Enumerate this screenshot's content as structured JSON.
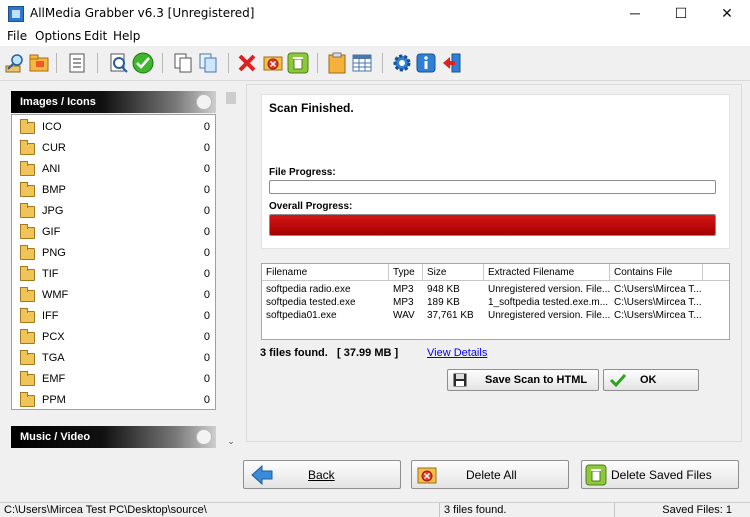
{
  "window": {
    "title": "AllMedia Grabber v6.3 [Unregistered]",
    "minimize": "─",
    "maximize": "☐",
    "close": "✕"
  },
  "menu": [
    "File",
    "Options",
    "Edit",
    "Help"
  ],
  "toolbar": {
    "icons": [
      "search-icon",
      "open-folder-icon",
      "list-icon",
      "scan-icon",
      "start-check-icon",
      "copy-icon",
      "duplicate-icon",
      "delete-x-icon",
      "delete-file-icon",
      "delete-saved-icon",
      "clipboard-icon",
      "table-icon",
      "settings-gear-icon",
      "info-icon",
      "exit-icon"
    ]
  },
  "categories": {
    "images": {
      "title": "Images / Icons",
      "items": [
        {
          "label": "ICO",
          "count": "0"
        },
        {
          "label": "CUR",
          "count": "0"
        },
        {
          "label": "ANI",
          "count": "0"
        },
        {
          "label": "BMP",
          "count": "0"
        },
        {
          "label": "JPG",
          "count": "0"
        },
        {
          "label": "GIF",
          "count": "0"
        },
        {
          "label": "PNG",
          "count": "0"
        },
        {
          "label": "TIF",
          "count": "0"
        },
        {
          "label": "WMF",
          "count": "0"
        },
        {
          "label": "IFF",
          "count": "0"
        },
        {
          "label": "PCX",
          "count": "0"
        },
        {
          "label": "TGA",
          "count": "0"
        },
        {
          "label": "EMF",
          "count": "0"
        },
        {
          "label": "PPM",
          "count": "0"
        }
      ]
    },
    "music": {
      "title": "Music / Video"
    }
  },
  "scan": {
    "status": "Scan Finished.",
    "file_progress_label": "File Progress:",
    "file_progress": 0,
    "overall_progress_label": "Overall Progress:",
    "overall_progress": 1.0
  },
  "results": {
    "columns": [
      "Filename",
      "Type",
      "Size",
      "Extracted Filename",
      "Contains File"
    ],
    "rows": [
      [
        "softpedia radio.exe",
        "MP3",
        "948 KB",
        "Unregistered version. File...",
        "C:\\Users\\Mircea T..."
      ],
      [
        "softpedia tested.exe",
        "MP3",
        "189 KB",
        "1_softpedia tested.exe.m...",
        "C:\\Users\\Mircea T..."
      ],
      [
        "softpedia01.exe",
        "WAV",
        "37,761 KB",
        "Unregistered version. File...",
        "C:\\Users\\Mircea T..."
      ]
    ]
  },
  "summary": {
    "found": "3 files found.",
    "size": "[ 37.99 MB ]",
    "view_details": "View Details"
  },
  "buttons": {
    "save_html": "Save Scan to HTML",
    "ok": "OK",
    "back": "Back",
    "delete_all": "Delete All",
    "delete_saved": "Delete Saved Files"
  },
  "statusbar": {
    "path": "C:\\Users\\Mircea Test PC\\Desktop\\source\\",
    "found": "3 files found.",
    "saved": "Saved Files: 1"
  },
  "colors": {
    "progress_fill": "#c40000",
    "link": "#0000ee"
  }
}
